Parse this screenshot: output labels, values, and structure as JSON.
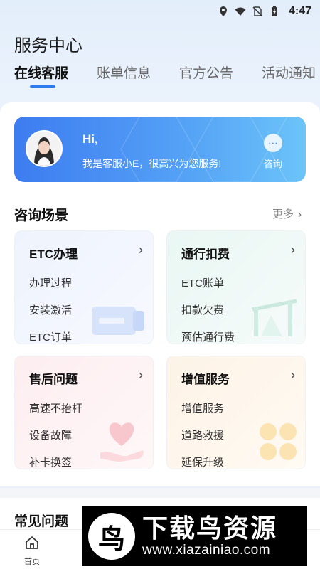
{
  "status_bar": {
    "time": "4:47",
    "icons": [
      "location-icon",
      "wifi-icon",
      "no-sim-icon",
      "battery-charging-icon"
    ]
  },
  "page_title": "服务中心",
  "tabs": [
    {
      "label": "在线客服",
      "active": true
    },
    {
      "label": "账单信息",
      "active": false
    },
    {
      "label": "官方公告",
      "active": false
    },
    {
      "label": "活动通知",
      "active": false
    }
  ],
  "banner": {
    "greeting": "Hi,",
    "subtitle": "我是客服小E，很高兴为您服务!",
    "consult_label": "咨询",
    "colors": {
      "start": "#3d7cf0",
      "end": "#6cc4f8"
    }
  },
  "scenarios": {
    "title": "咨询场景",
    "more_label": "更多",
    "tiles": [
      {
        "title": "ETC办理",
        "items": [
          "办理过程",
          "安装激活",
          "ETC订单"
        ],
        "icon": "etc-card-icon"
      },
      {
        "title": "通行扣费",
        "items": [
          "ETC账单",
          "扣款欠费",
          "预估通行费"
        ],
        "icon": "toll-gate-icon"
      },
      {
        "title": "售后问题",
        "items": [
          "高速不抬杆",
          "设备故障",
          "补卡换签"
        ],
        "icon": "heart-hand-icon"
      },
      {
        "title": "增值服务",
        "items": [
          "增值服务",
          "道路救援",
          "延保升级"
        ],
        "icon": "clover-icon"
      }
    ]
  },
  "faq": {
    "title": "常见问题"
  },
  "tabbar": {
    "home_label": "首页"
  },
  "watermark": {
    "name": "下载鸟资源",
    "url": "www.xiazainiao.com",
    "logo_char": "鸟"
  },
  "accent_color": "#2e7bf0"
}
